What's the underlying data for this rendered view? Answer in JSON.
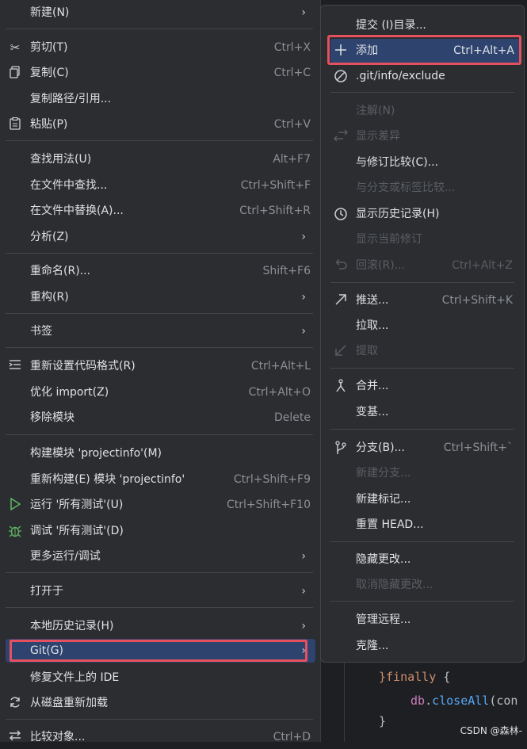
{
  "left_menu": [
    {
      "label": "新建(N)",
      "shortcut": "",
      "icon": "",
      "submenu": true
    },
    {
      "label": "剪切(T)",
      "shortcut": "Ctrl+X",
      "icon": "scissors-icon",
      "submenu": false
    },
    {
      "label": "复制(C)",
      "shortcut": "Ctrl+C",
      "icon": "copy-icon",
      "submenu": false
    },
    {
      "label": "复制路径/引用...",
      "shortcut": "",
      "icon": "",
      "submenu": false
    },
    {
      "label": "粘贴(P)",
      "shortcut": "Ctrl+V",
      "icon": "paste-icon",
      "submenu": false
    },
    {
      "label": "查找用法(U)",
      "shortcut": "Alt+F7",
      "icon": "",
      "submenu": false
    },
    {
      "label": "在文件中查找...",
      "shortcut": "Ctrl+Shift+F",
      "icon": "",
      "submenu": false
    },
    {
      "label": "在文件中替换(A)...",
      "shortcut": "Ctrl+Shift+R",
      "icon": "",
      "submenu": false
    },
    {
      "label": "分析(Z)",
      "shortcut": "",
      "icon": "",
      "submenu": true
    },
    {
      "label": "重命名(R)...",
      "shortcut": "Shift+F6",
      "icon": "",
      "submenu": false
    },
    {
      "label": "重构(R)",
      "shortcut": "",
      "icon": "",
      "submenu": true
    },
    {
      "label": "书签",
      "shortcut": "",
      "icon": "",
      "submenu": true
    },
    {
      "label": "重新设置代码格式(R)",
      "shortcut": "Ctrl+Alt+L",
      "icon": "reformat-icon",
      "submenu": false
    },
    {
      "label": "优化 import(Z)",
      "shortcut": "Ctrl+Alt+O",
      "icon": "",
      "submenu": false
    },
    {
      "label": "移除模块",
      "shortcut": "Delete",
      "icon": "",
      "submenu": false
    },
    {
      "label": "构建模块 'projectinfo'(M)",
      "shortcut": "",
      "icon": "",
      "submenu": false
    },
    {
      "label": "重新构建(E) 模块 'projectinfo'",
      "shortcut": "Ctrl+Shift+F9",
      "icon": "",
      "submenu": false
    },
    {
      "label": "运行 '所有测试'(U)",
      "shortcut": "Ctrl+Shift+F10",
      "icon": "run-icon",
      "submenu": false
    },
    {
      "label": "调试 '所有测试'(D)",
      "shortcut": "",
      "icon": "debug-icon",
      "submenu": false
    },
    {
      "label": "更多运行/调试",
      "shortcut": "",
      "icon": "",
      "submenu": true
    },
    {
      "label": "打开于",
      "shortcut": "",
      "icon": "",
      "submenu": true
    },
    {
      "label": "本地历史记录(H)",
      "shortcut": "",
      "icon": "",
      "submenu": true
    },
    {
      "label": "Git(G)",
      "shortcut": "",
      "icon": "",
      "submenu": true
    },
    {
      "label": "修复文件上的 IDE",
      "shortcut": "",
      "icon": "",
      "submenu": false
    },
    {
      "label": "从磁盘重新加载",
      "shortcut": "",
      "icon": "reload-icon",
      "submenu": false
    },
    {
      "label": "比较对象...",
      "shortcut": "Ctrl+D",
      "icon": "compare-icon",
      "submenu": false
    }
  ],
  "git_submenu": [
    {
      "label": "提交 (I)目录...",
      "shortcut": "",
      "icon": "",
      "disabled": false
    },
    {
      "label": "添加",
      "shortcut": "Ctrl+Alt+A",
      "icon": "plus-icon",
      "disabled": false
    },
    {
      "label": ".git/info/exclude",
      "shortcut": "",
      "icon": "ignore-icon",
      "disabled": false
    },
    {
      "label": "注解(N)",
      "shortcut": "",
      "icon": "",
      "disabled": true
    },
    {
      "label": "显示差异",
      "shortcut": "",
      "icon": "diff-icon",
      "disabled": true
    },
    {
      "label": "与修订比较(C)...",
      "shortcut": "",
      "icon": "",
      "disabled": false
    },
    {
      "label": "与分支或标签比较...",
      "shortcut": "",
      "icon": "",
      "disabled": true
    },
    {
      "label": "显示历史记录(H)",
      "shortcut": "",
      "icon": "history-icon",
      "disabled": false
    },
    {
      "label": "显示当前修订",
      "shortcut": "",
      "icon": "",
      "disabled": true
    },
    {
      "label": "回滚(R)...",
      "shortcut": "Ctrl+Alt+Z",
      "icon": "rollback-icon",
      "disabled": true
    },
    {
      "label": "推送...",
      "shortcut": "Ctrl+Shift+K",
      "icon": "push-icon",
      "disabled": false
    },
    {
      "label": "拉取...",
      "shortcut": "",
      "icon": "",
      "disabled": false
    },
    {
      "label": "提取",
      "shortcut": "",
      "icon": "fetch-icon",
      "disabled": true
    },
    {
      "label": "合并...",
      "shortcut": "",
      "icon": "merge-icon",
      "disabled": false
    },
    {
      "label": "变基...",
      "shortcut": "",
      "icon": "",
      "disabled": false
    },
    {
      "label": "分支(B)...",
      "shortcut": "Ctrl+Shift+`",
      "icon": "branch-icon",
      "disabled": false
    },
    {
      "label": "新建分支...",
      "shortcut": "",
      "icon": "",
      "disabled": true
    },
    {
      "label": "新建标记...",
      "shortcut": "",
      "icon": "",
      "disabled": false
    },
    {
      "label": "重置 HEAD...",
      "shortcut": "",
      "icon": "",
      "disabled": false
    },
    {
      "label": "隐藏更改...",
      "shortcut": "",
      "icon": "",
      "disabled": false
    },
    {
      "label": "取消隐藏更改...",
      "shortcut": "",
      "icon": "",
      "disabled": true
    },
    {
      "label": "管理远程...",
      "shortcut": "",
      "icon": "",
      "disabled": false
    },
    {
      "label": "克隆...",
      "shortcut": "",
      "icon": "",
      "disabled": false
    }
  ],
  "editor": {
    "line1_kw": "}finally",
    "line1_brace": " {",
    "line2_var": "db",
    "line2_dot": ".",
    "line2_fn": "closeAll",
    "line2_rest": "(con",
    "line3": "}"
  },
  "watermark": "CSDN @森林-",
  "colors": {
    "highlight_border": "#e5505e",
    "selection": "#2e436e",
    "menu_bg": "#2b2d30"
  }
}
